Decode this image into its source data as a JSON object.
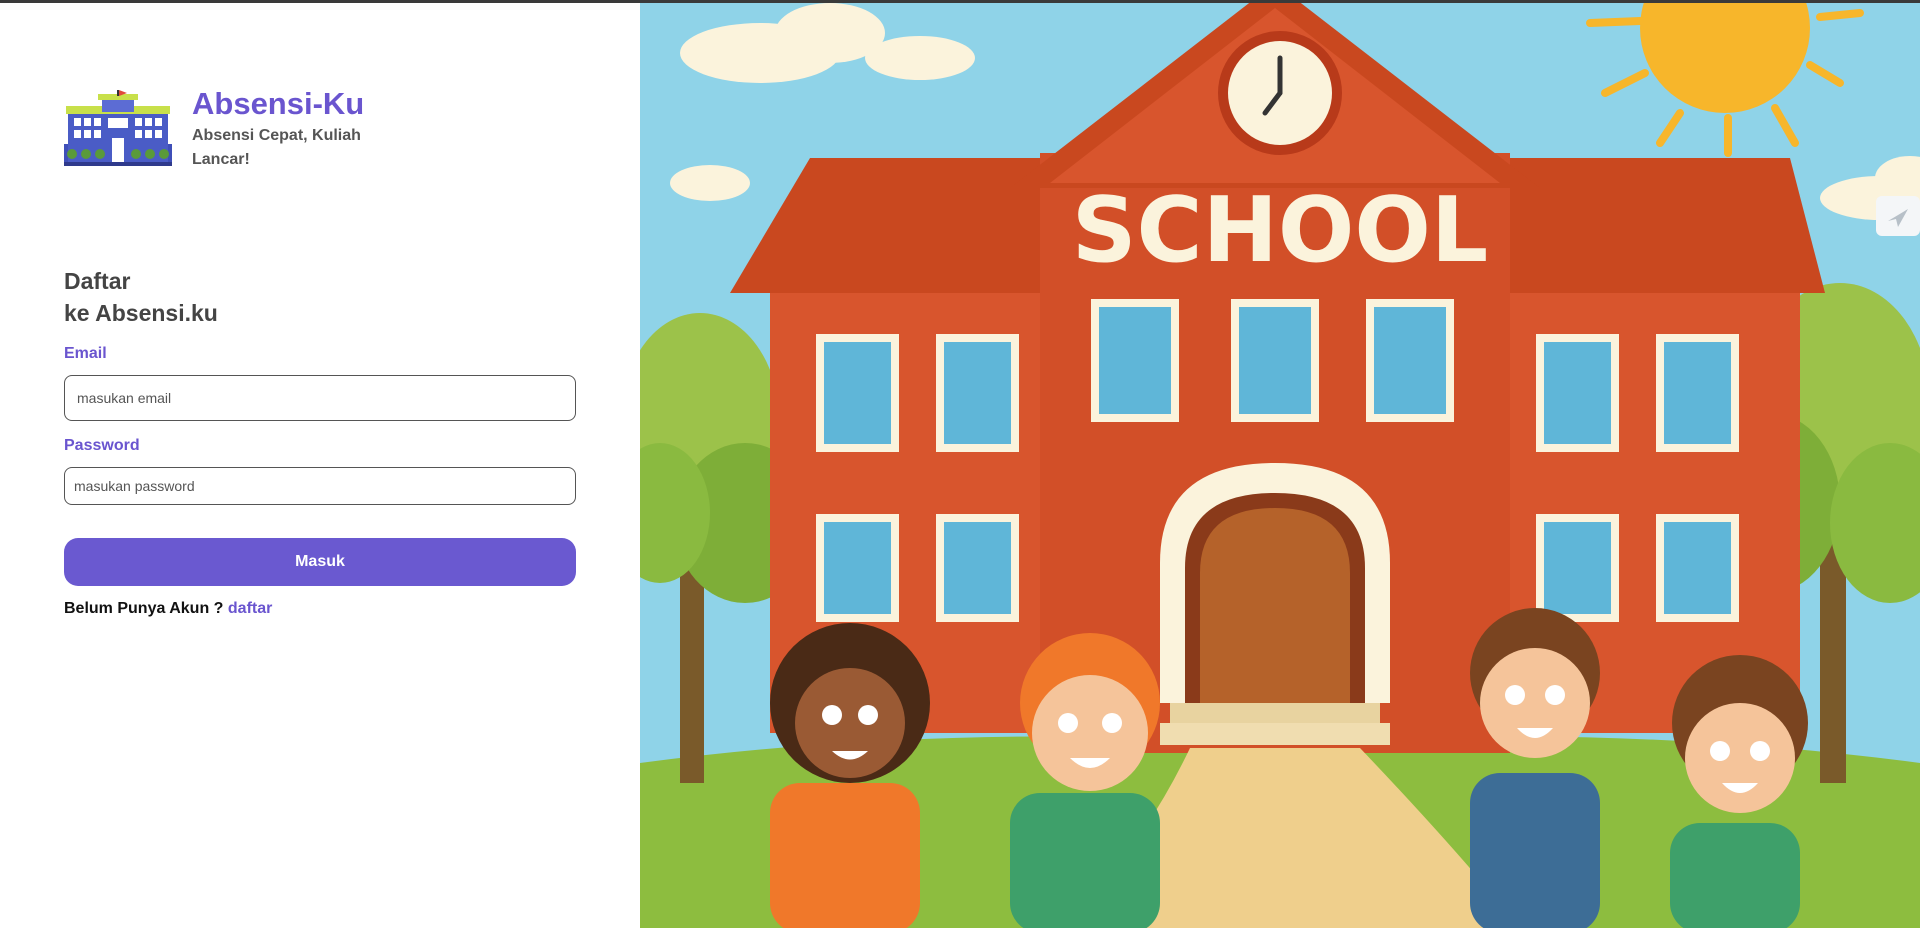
{
  "brand": {
    "name": "Absensi-Ku",
    "tagline": "Absensi Cepat, Kuliah Lancar!"
  },
  "form": {
    "heading_line1": "Daftar",
    "heading_line2": "ke Absensi.ku",
    "email_label": "Email",
    "email_placeholder": "masukan email",
    "password_label": "Password",
    "password_placeholder": "masukan password",
    "submit_label": "Masuk",
    "register_prompt": "Belum Punya Akun ?",
    "register_link": "daftar"
  },
  "hero": {
    "sign_text": "SCHOOL"
  },
  "colors": {
    "accent": "#6a55cf",
    "button": "#6a59d0",
    "sky": "#8fd3e8",
    "brick": "#d8552d",
    "roof": "#c9481f",
    "grass": "#8dbd3f",
    "sun": "#f7b62b"
  },
  "icons": {
    "logo": "school-building-icon",
    "side_tab": "send-icon"
  }
}
